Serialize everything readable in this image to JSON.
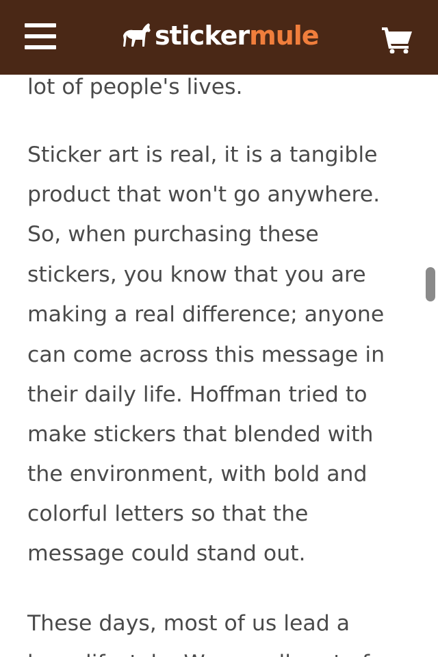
{
  "header": {
    "logo": {
      "sticker": "sticker",
      "mule": "mule"
    },
    "menu_icon": "hamburger-menu-icon",
    "cart_icon": "shopping-cart-icon",
    "background": "#4a2816",
    "accent": "#f07e3c"
  },
  "article": {
    "paragraph1_tail": [
      "lot of people's lives."
    ],
    "paragraph2": [
      "Sticker art is real, it is a tangible",
      "product that won't go anywhere.",
      "So, when purchasing these",
      "stickers, you know that you are",
      "making a real difference; anyone",
      "can come across this message in",
      "their daily life. Hoffman tried to",
      "make stickers that blended with",
      "the environment, with bold and",
      "colorful letters so that the",
      "message could stand out."
    ],
    "paragraph3": [
      "These days, most of us lead a",
      "busy lifestyle. We are all part of"
    ]
  }
}
